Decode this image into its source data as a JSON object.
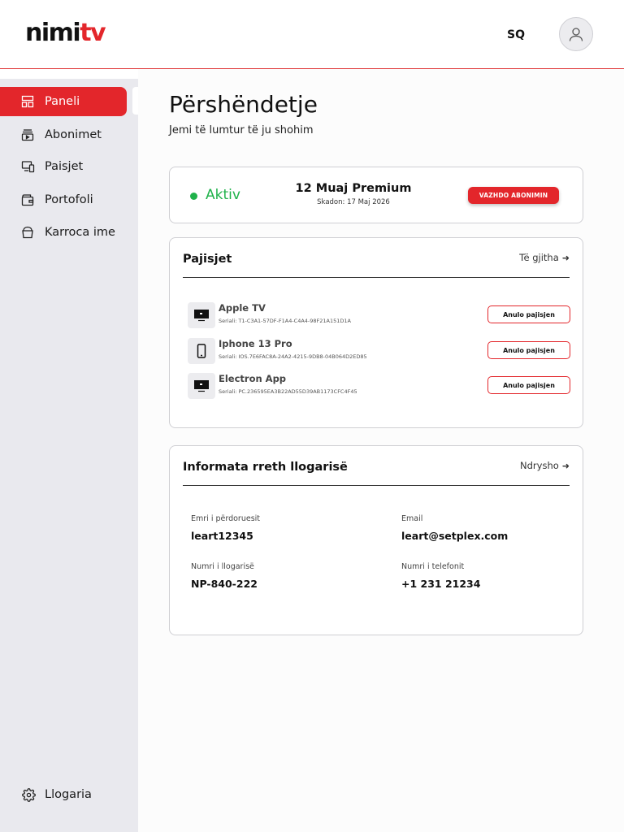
{
  "header": {
    "logo_left": "nimi",
    "logo_right": "tv",
    "language": "SQ"
  },
  "sidebar": {
    "items": [
      {
        "label": "Paneli",
        "icon": "dashboard-icon",
        "active": true
      },
      {
        "label": "Abonimet",
        "icon": "subscriptions-icon",
        "active": false
      },
      {
        "label": "Paisjet",
        "icon": "devices-icon",
        "active": false
      },
      {
        "label": "Portofoli",
        "icon": "wallet-icon",
        "active": false
      },
      {
        "label": "Karroca ime",
        "icon": "cart-icon",
        "active": false
      }
    ],
    "settings_label": "Llogaria"
  },
  "main": {
    "greeting": "Përshëndetje",
    "subtitle": "Jemi të lumtur të ju shohim"
  },
  "subscription": {
    "status": "Aktiv",
    "plan": "12 Muaj Premium",
    "expires": "Skadon: 17 Maj 2026",
    "button": "VAZHDO ABONIMIN"
  },
  "devices": {
    "title": "Pajisjet",
    "link": "Të gjitha",
    "items": [
      {
        "name": "Apple TV",
        "serial": "Seriali: T1-C3A1-57DF-F1A4-C4A4-98F21A151D1A",
        "icon": "tv-icon",
        "action": "Anulo pajisjen"
      },
      {
        "name": "Iphone 13 Pro",
        "serial": "Seriali: IOS.7E6FAC8A-24A2-4215-9DB8-04B064D2ED85",
        "icon": "phone-icon",
        "action": "Anulo pajisjen"
      },
      {
        "name": "Electron App",
        "serial": "Seriali: PC.236595EA3B22AD55D39AB1173CFC4F45",
        "icon": "tv-icon",
        "action": "Anulo pajisjen"
      }
    ]
  },
  "account": {
    "title": "Informata rreth llogarisë",
    "link": "Ndrysho",
    "username_label": "Emri i përdoruesit",
    "username": "leart12345",
    "email_label": "Email",
    "email": "leart@setplex.com",
    "account_number_label": "Numri i llogarisë",
    "account_number": "NP-840-222",
    "phone_label": "Numri i telefonit",
    "phone": "+1 231 21234"
  },
  "colors": {
    "accent": "#e3262b",
    "active_status": "#20b24b",
    "sidebar_bg": "#e9e9ee"
  }
}
